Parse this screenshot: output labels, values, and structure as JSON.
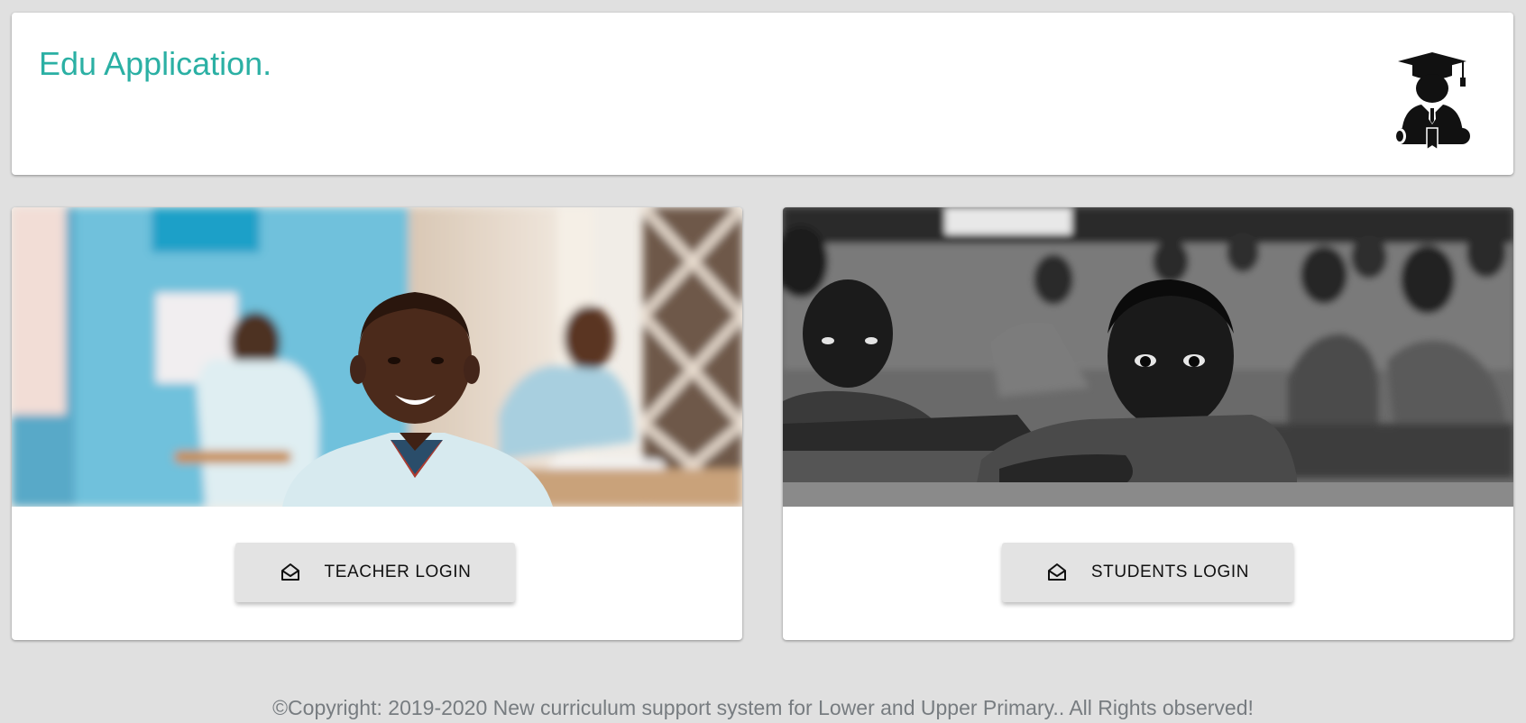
{
  "header": {
    "title": "Edu Application.",
    "icon": "graduate-icon"
  },
  "cards": [
    {
      "image": "smiling-student-photo",
      "button_label": "TEACHER LOGIN",
      "button_icon": "envelope-open-icon"
    },
    {
      "image": "classroom-children-photo",
      "button_label": "STUDENTS LOGIN",
      "button_icon": "envelope-open-icon"
    }
  ],
  "footer": {
    "copyright": "©Copyright: 2019-2020 New curriculum support system for Lower and Upper Primary.. All Rights observed!"
  },
  "colors": {
    "brand": "#2bb0a4",
    "background": "#e0e0e0",
    "button": "#e3e3e3"
  }
}
